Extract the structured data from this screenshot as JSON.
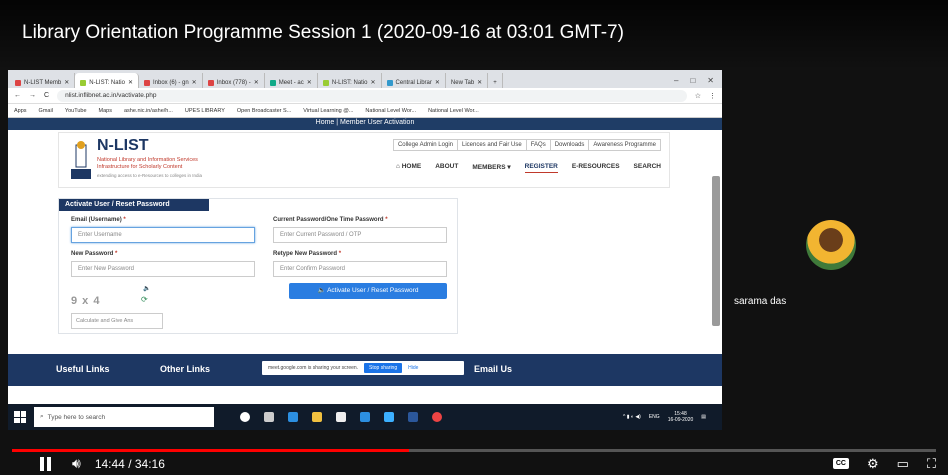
{
  "video": {
    "title": "Library Orientation Programme Session 1 (2020-09-16 at 03:01 GMT-7)",
    "time": "14:44 / 34:16",
    "progress": 0.43
  },
  "participant": {
    "name": "sarama das"
  },
  "browser": {
    "tabs": [
      "N-LIST Memb",
      "N-LIST: Natio",
      "Inbox (6) - gn",
      "Inbox (778) -",
      "Meet - ac",
      "N-LIST: Natio",
      "Central Librar",
      "New Tab"
    ],
    "url": "nlist.inflibnet.ac.in/vactivate.php",
    "bookmarks": [
      "Apps",
      "Gmail",
      "YouTube",
      "Maps",
      "ashe.nic.in/ashe/h...",
      "UPES LIBRARY",
      "Open Broadcaster S...",
      "Virtual Learning @...",
      "National Level Wor...",
      "National Level Wor..."
    ]
  },
  "site": {
    "breadcrumb": "Home   |   Member User Activation",
    "brand": "N-LIST",
    "brand_sub": "National Library and Information Services\nInfrastructure for Scholarly Content",
    "brand_tag": "extending access to e-Resources to colleges in India",
    "logo_label": "INFLIBNET",
    "toplinks": [
      "College Admin Login",
      "Licences and Fair Use",
      "FAQs",
      "Downloads",
      "Awareness Programme"
    ],
    "nav": [
      "HOME",
      "ABOUT",
      "MEMBERS ▾",
      "REGISTER",
      "E-RESOURCES",
      "SEARCH"
    ],
    "form": {
      "heading": "Activate User / Reset Password",
      "email_label": "Email (Username)",
      "email_placeholder": "Enter Username",
      "current_label": "Current Password/One Time Password",
      "current_placeholder": "Enter Current Password / OTP",
      "new_label": "New Password",
      "new_placeholder": "Enter New Password",
      "retype_label": "Retype New Password",
      "retype_placeholder": "Enter Confirm Password",
      "captcha": "9 x 4",
      "calc_placeholder": "Calculate and Give Ans",
      "submit": "Activate User / Reset Password"
    },
    "footer": {
      "useful": "Useful Links",
      "other": "Other Links",
      "email": "Email Us"
    }
  },
  "share_bar": {
    "text": "meet.google.com is sharing your screen.",
    "stop": "Stop sharing",
    "hide": "Hide"
  },
  "taskbar": {
    "search": "Type here to search",
    "time": "15:48",
    "date": "16-09-2020",
    "lang": "ENG"
  }
}
